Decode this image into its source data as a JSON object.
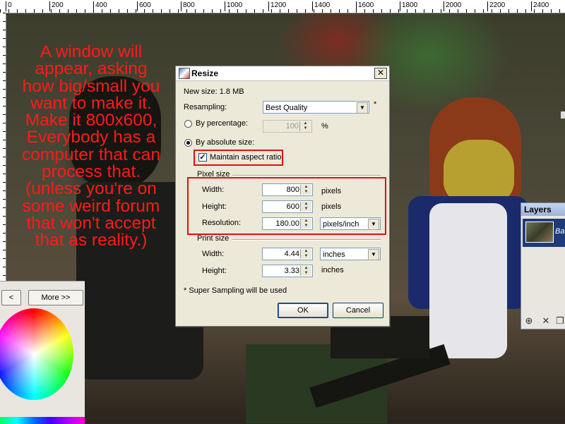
{
  "ruler": {
    "marks": [
      "0",
      "200",
      "400",
      "600",
      "800",
      "1000",
      "1200",
      "1400",
      "1600",
      "1800",
      "2000",
      "2200",
      "2400"
    ]
  },
  "annotation": {
    "lines": [
      "A window will",
      "appear, asking",
      "how big/small you",
      "want to make it.",
      "Make it 800x600,",
      "Everybody has a",
      "computer that can",
      "process that.",
      "(unless you're on",
      "some weird forum",
      "that won't accept",
      "that as reality.)"
    ],
    "color": "#ff1a1a"
  },
  "colors_panel": {
    "more_label": "More >>"
  },
  "layers": {
    "title": "Layers",
    "row_text": "Ba"
  },
  "dialog": {
    "title": "Resize",
    "close_glyph": "✕",
    "new_size": "New size: 1.8 MB",
    "resampling_label": "Resampling:",
    "resampling_value": "Best Quality",
    "resampling_star": "*",
    "by_percentage_label": "By percentage:",
    "percentage_value": "100",
    "percent_sign": "%",
    "by_absolute_label": "By absolute size:",
    "maintain_label": "Maintain aspect ratio",
    "maintain_checked": "✓",
    "pixel_size_label": "Pixel size",
    "width_label": "Width:",
    "width_value": "800",
    "width_unit": "pixels",
    "height_label": "Height:",
    "height_value": "600",
    "height_unit": "pixels",
    "resolution_label": "Resolution:",
    "resolution_value": "180.00",
    "resolution_unit": "pixels/inch",
    "print_size_label": "Print size",
    "print_width_label": "Width:",
    "print_width_value": "4.44",
    "print_width_unit": "inches",
    "print_height_label": "Height:",
    "print_height_value": "3.33",
    "print_height_unit": "inches",
    "footnote": "* Super Sampling will be used",
    "ok_label": "OK",
    "cancel_label": "Cancel"
  }
}
